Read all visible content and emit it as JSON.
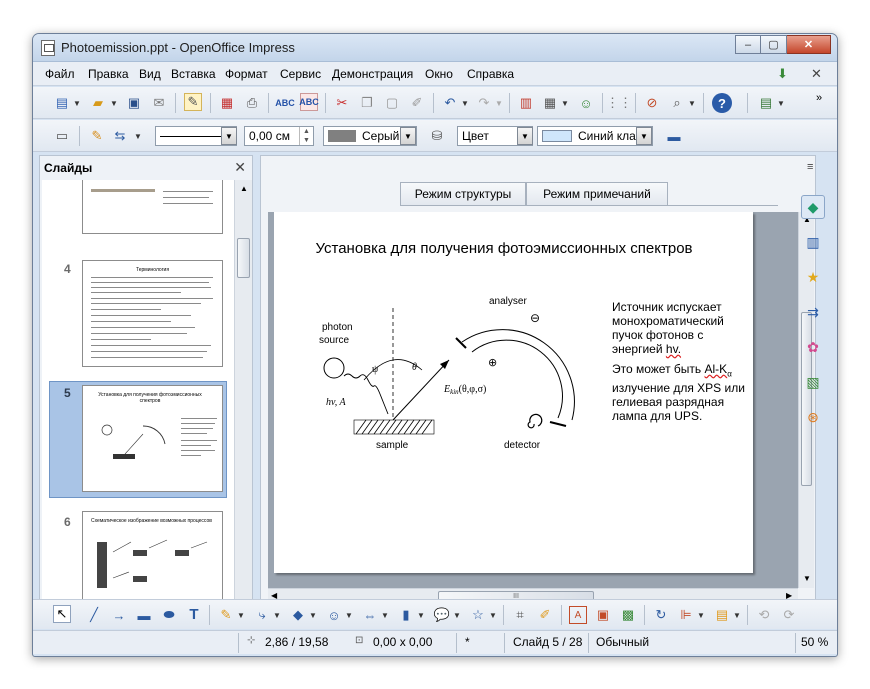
{
  "window": {
    "title": "Photoemission.ppt - OpenOffice Impress",
    "minimize": "‒",
    "maximize": "▢",
    "close": "✕"
  },
  "menu": {
    "items": [
      "Файл",
      "Правка",
      "Вид",
      "Вставка",
      "Формат",
      "Сервис",
      "Демонстрация",
      "Окно",
      "Справка"
    ],
    "close_doc": "✕"
  },
  "format_bar": {
    "line_width": "0,00 см",
    "line_color": "Серый",
    "area_style": "Цвет",
    "area_color": "Синий кла"
  },
  "slides_panel": {
    "title": "Слайды",
    "close": "✕",
    "slides": [
      {
        "number": "4",
        "title": "Терминология"
      },
      {
        "number": "5",
        "title": "Установка для получения фотоэмиссионных спектров"
      },
      {
        "number": "6",
        "title": "Схематическое изображение возможных процессов"
      }
    ]
  },
  "view_tabs": [
    "Режим структуры",
    "Режим примечаний"
  ],
  "slide": {
    "title": "Установка для получения фотоэмиссионных спектров",
    "body_para1": "Источник испускает монохроматический пучок фотонов с энергией",
    "body_para1_hv": "hv.",
    "body_para2_a": "Это может быть",
    "body_para2_alk": "Al-K",
    "body_para2_alpha": "α",
    "body_para2_b": "излучение для XPS или гелиевая разрядная лампа для UPS.",
    "diagram": {
      "photon_source_1": "photon",
      "photon_source_2": "source",
      "hv_a": "hv, A",
      "psi": "ψ",
      "theta": "θ",
      "ekin": "E",
      "ekin_sub": "kin",
      "ekin_args": "(θ,φ,σ)",
      "analyser": "analyser",
      "sample": "sample",
      "detector": "detector",
      "minus": "⊖",
      "plus": "⊕"
    }
  },
  "hscroll_label": "III",
  "status": {
    "position": "2,86 / 19,58",
    "size": "0,00 x 0,00",
    "modified": "*",
    "slide": "Слайд 5 / 28",
    "layout": "Обычный",
    "zoom": "50 %"
  },
  "accent_colors": {
    "selected_thumb": "#a9c4e6",
    "title_bar": "#c3d5ea"
  }
}
